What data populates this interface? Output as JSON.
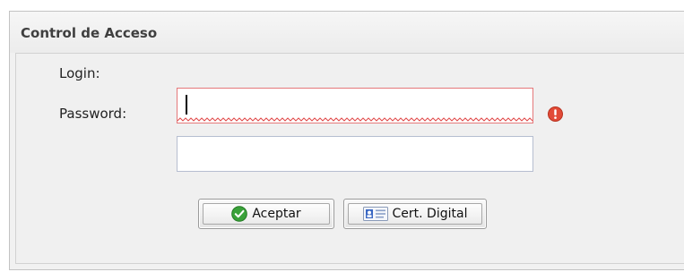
{
  "panel": {
    "title": "Control de Acceso"
  },
  "form": {
    "login": {
      "label": "Login:",
      "value": "",
      "placeholder": "",
      "state": "error"
    },
    "password": {
      "label": "Password:",
      "value": "",
      "placeholder": ""
    }
  },
  "buttons": {
    "accept": {
      "label": "Aceptar",
      "icon": "check-circle-icon"
    },
    "certificate": {
      "label": "Cert. Digital",
      "icon": "id-card-icon"
    }
  },
  "colors": {
    "error": "#e5787a",
    "error_icon": "#e24a37",
    "success_icon": "#3aa23a",
    "certificate_icon": "#3a68c4"
  }
}
